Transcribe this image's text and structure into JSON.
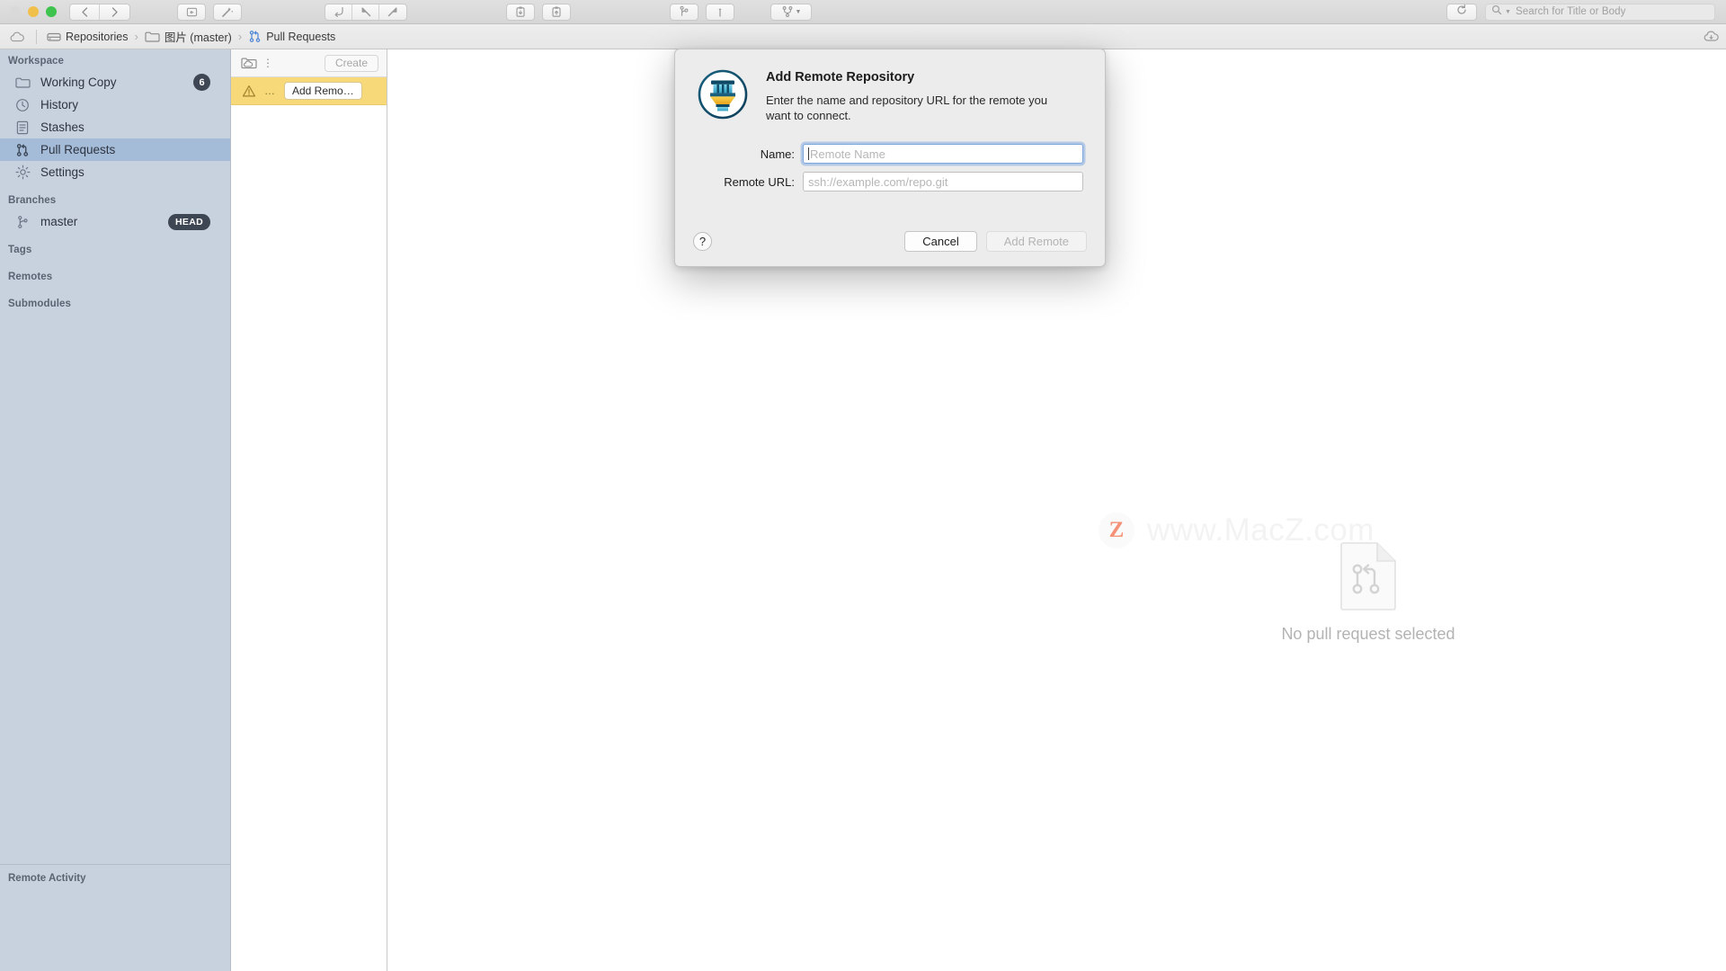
{
  "window": {
    "traffic_lights": [
      "close",
      "minimize",
      "zoom"
    ]
  },
  "toolbar": {
    "back_icon": "chevron-left-icon",
    "forward_icon": "chevron-right-icon",
    "buttons": [
      {
        "name": "commit-icon",
        "label": "Commit"
      },
      {
        "name": "quick-actions-wand-icon",
        "label": "Quick Actions"
      },
      {
        "name": "checkout-icon",
        "label": "Checkout"
      },
      {
        "name": "pull-icon",
        "label": "Pull"
      },
      {
        "name": "push-icon",
        "label": "Push"
      },
      {
        "name": "stash-icon",
        "label": "Stash"
      },
      {
        "name": "unstash-icon",
        "label": "Unstash"
      },
      {
        "name": "branch-icon",
        "label": "Branch"
      },
      {
        "name": "tag-icon",
        "label": "Tag"
      },
      {
        "name": "merge-icon",
        "label": "Merge"
      }
    ],
    "reload_icon": "reload-icon",
    "search": {
      "icon": "search-icon",
      "placeholder": "Search for Title or Body",
      "value": ""
    }
  },
  "breadcrumb": {
    "cloud_icon": "cloud-icon",
    "items": [
      {
        "icon": "repositories-icon",
        "label": "Repositories",
        "active": false
      },
      {
        "icon": "folder-icon",
        "label": "图片 (master)",
        "active": false
      },
      {
        "icon": "pull-request-icon",
        "label": "Pull Requests",
        "active": true
      }
    ],
    "separator": "›",
    "right_icon": "cloud-download-icon"
  },
  "sidebar": {
    "sections": [
      {
        "title": "Workspace",
        "items": [
          {
            "icon": "folder-icon",
            "label": "Working Copy",
            "badge": "6",
            "badge_type": "count",
            "selected": false
          },
          {
            "icon": "clock-icon",
            "label": "History",
            "badge": "",
            "badge_type": "",
            "selected": false
          },
          {
            "icon": "stash-list-icon",
            "label": "Stashes",
            "badge": "",
            "badge_type": "",
            "selected": false
          },
          {
            "icon": "pull-request-icon",
            "label": "Pull Requests",
            "badge": "",
            "badge_type": "",
            "selected": true
          },
          {
            "icon": "gear-icon",
            "label": "Settings",
            "badge": "",
            "badge_type": "",
            "selected": false
          }
        ]
      },
      {
        "title": "Branches",
        "items": [
          {
            "icon": "branch-icon",
            "label": "master",
            "badge": "HEAD",
            "badge_type": "head",
            "selected": false
          }
        ]
      },
      {
        "title": "Tags",
        "items": []
      },
      {
        "title": "Remotes",
        "items": []
      },
      {
        "title": "Submodules",
        "items": []
      }
    ],
    "footer_title": "Remote Activity"
  },
  "list_panel": {
    "header": {
      "cloud_folder_icon": "cloud-folder-icon",
      "overflow_icon": "vertical-dots-icon",
      "create_label": "Create"
    },
    "rows": [
      {
        "warning_icon": "warning-triangle-icon",
        "dots": "…",
        "action_label": "Add Remo…"
      }
    ]
  },
  "content": {
    "empty_state": {
      "icon": "pull-request-document-icon",
      "message": "No pull request selected"
    },
    "watermark": {
      "badge": "Z",
      "text": "www.MacZ.com"
    }
  },
  "dialog": {
    "app_icon": "tower-app-icon",
    "title": "Add Remote Repository",
    "description": "Enter the name and repository URL for the remote you want to connect.",
    "fields": [
      {
        "label": "Name:",
        "placeholder": "Remote Name",
        "value": "",
        "focused": true
      },
      {
        "label": "Remote URL:",
        "placeholder": "ssh://example.com/repo.git",
        "value": "",
        "focused": false
      }
    ],
    "help_label": "?",
    "cancel_label": "Cancel",
    "submit_label": "Add Remote",
    "submit_disabled": true
  },
  "colors": {
    "sidebar_bg": "#c8d2de",
    "sidebar_selected": "#a5bcd9",
    "row_highlight": "#f8d97a",
    "accent_blue": "#4f87d6",
    "badge_dark": "#3e4654",
    "watermark_orange": "#f04e23"
  }
}
